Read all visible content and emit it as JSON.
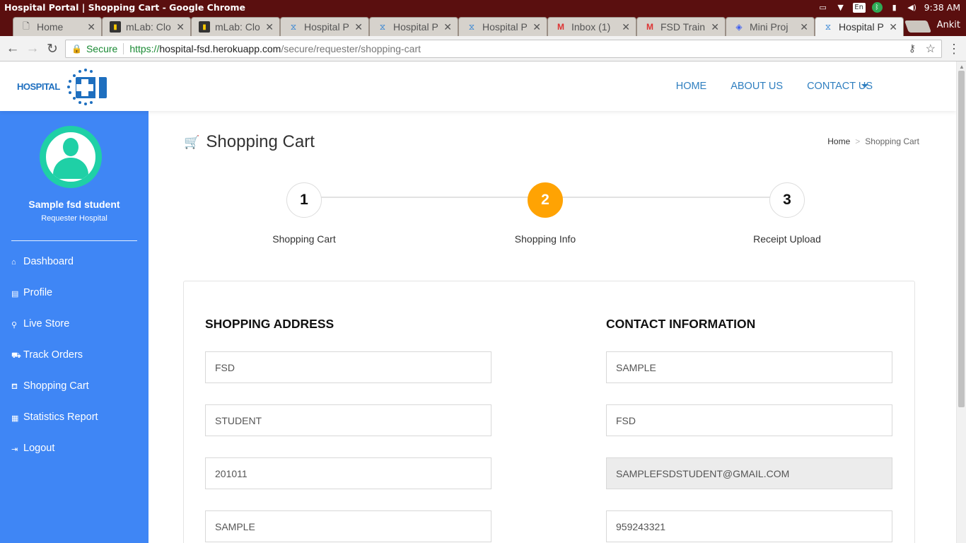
{
  "os_bar": {
    "window_title": "Hospital Portal | Shopping Cart - Google Chrome",
    "lang": "En",
    "time": "9:38 AM",
    "tray_icons": [
      "screen-icon",
      "wifi-icon",
      "keyboard-lang-icon",
      "bluetooth-icon",
      "battery-icon",
      "volume-icon"
    ]
  },
  "tabs": [
    {
      "label": "Home",
      "icon": "page-icon"
    },
    {
      "label": "mLab: Clo",
      "icon": "mlab-icon"
    },
    {
      "label": "mLab: Clo",
      "icon": "mlab-icon"
    },
    {
      "label": "Hospital P",
      "icon": "hospital-icon"
    },
    {
      "label": "Hospital P",
      "icon": "hospital-icon"
    },
    {
      "label": "Hospital P",
      "icon": "hospital-icon"
    },
    {
      "label": "Inbox (1)",
      "icon": "gmail-icon"
    },
    {
      "label": "FSD Train",
      "icon": "gmail-icon"
    },
    {
      "label": "Mini Proj",
      "icon": "dropbox-icon"
    },
    {
      "label": "Hospital P",
      "icon": "hospital-icon",
      "active": true
    }
  ],
  "browser": {
    "user": "Ankit",
    "secure_label": "Secure",
    "url_scheme": "https://",
    "url_host": "hospital-fsd.herokuapp.com",
    "url_path": "/secure/requester/shopping-cart"
  },
  "header": {
    "logo_text": "HOSPITAL",
    "nav": [
      "HOME",
      "ABOUT US",
      "CONTACT US"
    ]
  },
  "sidebar": {
    "user_name": "Sample fsd student",
    "user_role": "Requester Hospital",
    "items": [
      {
        "label": "Dashboard",
        "icon": "home-icon"
      },
      {
        "label": "Profile",
        "icon": "id-card-icon"
      },
      {
        "label": "Live Store",
        "icon": "search-icon"
      },
      {
        "label": "Track Orders",
        "icon": "truck-icon"
      },
      {
        "label": "Shopping Cart",
        "icon": "cart-icon"
      },
      {
        "label": "Statistics Report",
        "icon": "report-icon"
      },
      {
        "label": "Logout",
        "icon": "logout-icon"
      }
    ]
  },
  "main": {
    "title": "Shopping Cart",
    "breadcrumb": {
      "home": "Home",
      "separator": ">",
      "current": "Shopping Cart"
    },
    "steps": [
      {
        "number": "1",
        "label": "Shopping Cart",
        "active": false
      },
      {
        "number": "2",
        "label": "Shopping Info",
        "active": true
      },
      {
        "number": "3",
        "label": "Receipt Upload",
        "active": false
      }
    ],
    "shopping_address": {
      "heading": "SHOPPING ADDRESS",
      "fields": [
        "FSD",
        "STUDENT",
        "201011",
        "SAMPLE"
      ]
    },
    "contact_information": {
      "heading": "CONTACT INFORMATION",
      "fields": [
        "SAMPLE",
        "FSD",
        "SAMPLEFSDSTUDENT@GMAIL.COM",
        "959243321"
      ]
    }
  },
  "colors": {
    "sidebar_bg": "#3f86f5",
    "avatar_accent": "#1fd0a6",
    "active_step": "#ffa303",
    "nav_link": "#2f7fc0",
    "titlebar": "#5a0f0f"
  }
}
